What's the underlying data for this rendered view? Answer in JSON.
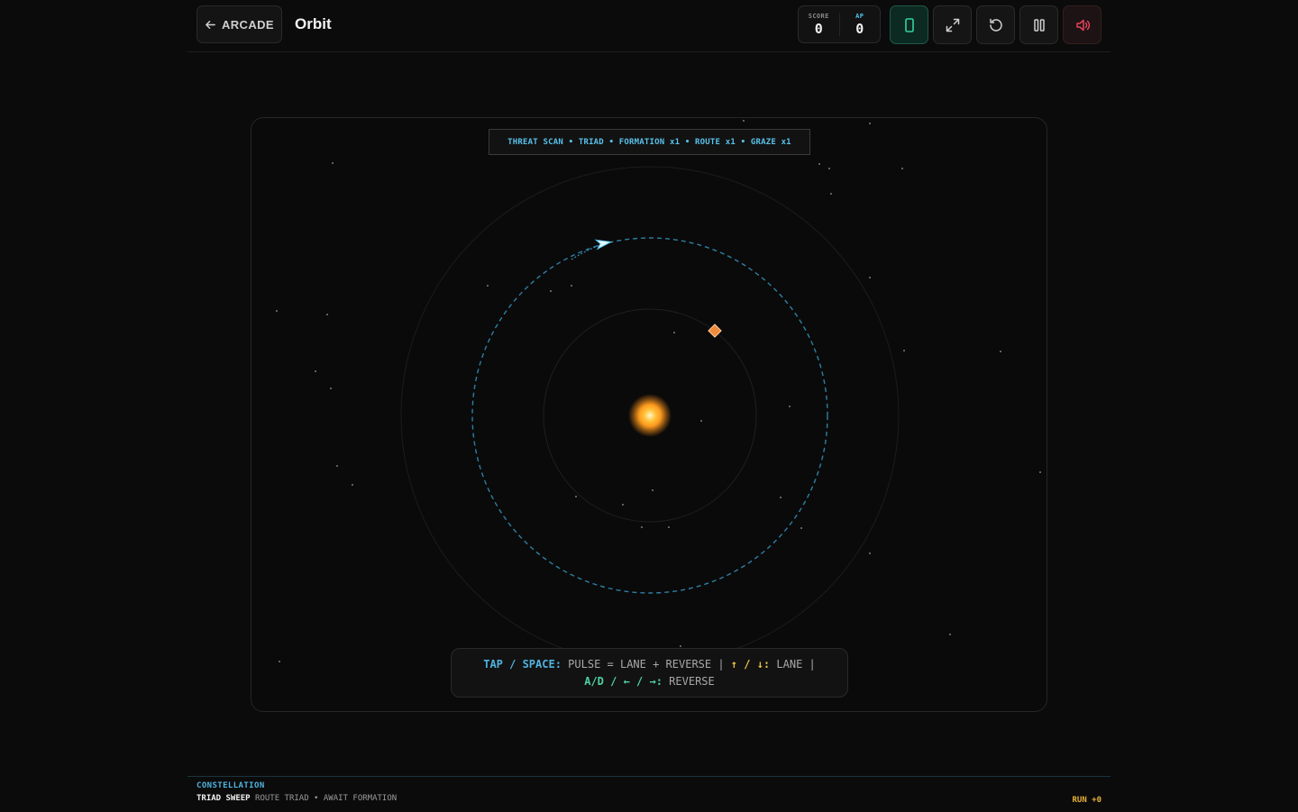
{
  "header": {
    "back_label": "ARCADE",
    "title": "Orbit",
    "score_label": "SCORE",
    "score_value": "0",
    "ap_label": "AP",
    "ap_value": "0"
  },
  "banner": {
    "text": "THREAT SCAN • TRIAD • FORMATION x1 • ROUTE x1 • GRAZE x1"
  },
  "help": {
    "key1": "TAP / SPACE:",
    "desc1": "PULSE = LANE + REVERSE |",
    "key2": "↑ / ↓:",
    "desc2": "LANE |",
    "key3": "A/D / ← / →:",
    "desc3": "REVERSE"
  },
  "footer": {
    "label": "CONSTELLATION",
    "mode": "TRIAD SWEEP",
    "status": "ROUTE TRIAD • AWAIT FORMATION",
    "run": "RUN +0"
  },
  "colors": {
    "accent_blue": "#4fb3e0",
    "accent_green": "#4fd1a0",
    "accent_yellow": "#e8c24a",
    "sun": "#ffb43a",
    "enemy": "#f08a3c",
    "sound_icon": "#e0455a"
  },
  "icons": {
    "back": "arrow-left-icon",
    "phone": "phone-icon",
    "fullscreen": "expand-icon",
    "restart": "restart-icon",
    "pause": "pause-icon",
    "sound": "volume-icon"
  }
}
